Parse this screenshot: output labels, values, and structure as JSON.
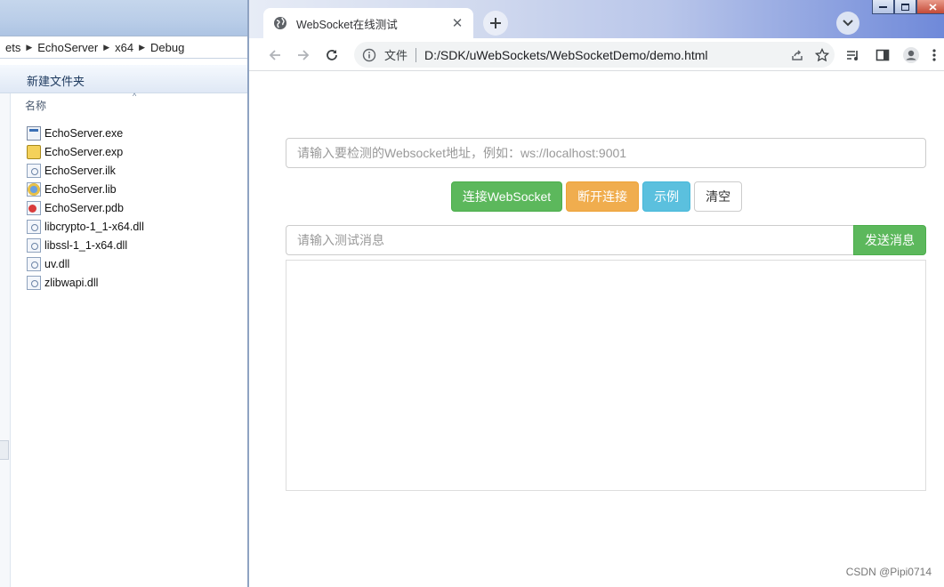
{
  "explorer": {
    "breadcrumb": [
      "ets",
      "EchoServer",
      "x64",
      "Debug"
    ],
    "toolbar_new_folder": "新建文件夹",
    "column_name": "名称",
    "files": [
      {
        "name": "EchoServer.exe",
        "icon": "exe-file-icon"
      },
      {
        "name": "EchoServer.exp",
        "icon": "exp-file-icon"
      },
      {
        "name": "EchoServer.ilk",
        "icon": "ilk-file-icon"
      },
      {
        "name": "EchoServer.lib",
        "icon": "lib-file-icon"
      },
      {
        "name": "EchoServer.pdb",
        "icon": "pdb-file-icon"
      },
      {
        "name": "libcrypto-1_1-x64.dll",
        "icon": "dll-file-icon"
      },
      {
        "name": "libssl-1_1-x64.dll",
        "icon": "dll-file-icon"
      },
      {
        "name": "uv.dll",
        "icon": "dll-file-icon"
      },
      {
        "name": "zlibwapi.dll",
        "icon": "dll-file-icon"
      }
    ]
  },
  "browser": {
    "tab": {
      "title": "WebSocket在线测试"
    },
    "omnibox": {
      "scheme_label": "文件",
      "url": "D:/SDK/uWebSockets/WebSocketDemo/demo.html"
    }
  },
  "page": {
    "ws_url_placeholder": "请输入要检测的Websocket地址，例如：ws://localhost:9001",
    "buttons": {
      "connect": "连接WebSocket",
      "disconnect": "断开连接",
      "example": "示例",
      "clear": "清空"
    },
    "message_placeholder": "请输入测试消息",
    "send_label": "发送消息",
    "log_content": "",
    "watermark": "CSDN @Pipi0714"
  },
  "colors": {
    "success": "#5cb85c",
    "warning": "#f0ad4e",
    "info": "#5bc0de"
  }
}
